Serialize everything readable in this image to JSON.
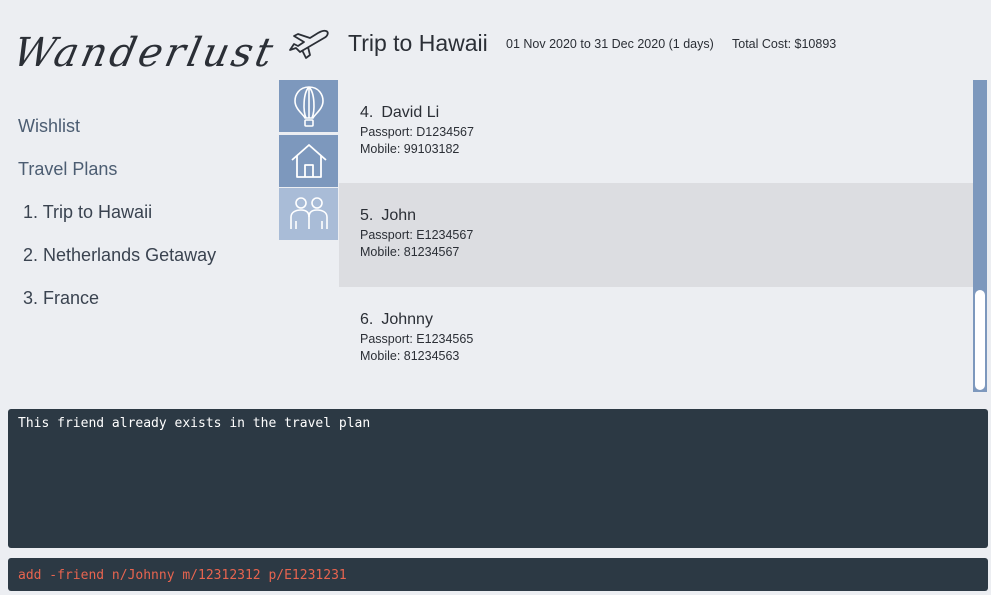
{
  "app": {
    "logo_text": "Wanderlust"
  },
  "sidebar": {
    "wishlist_label": "Wishlist",
    "travel_plans_label": "Travel Plans",
    "plans": [
      {
        "index": "1.",
        "name": "Trip to Hawaii"
      },
      {
        "index": "2.",
        "name": "Netherlands Getaway"
      },
      {
        "index": "3.",
        "name": "France"
      }
    ]
  },
  "header": {
    "title": "Trip to Hawaii",
    "dates": "01 Nov 2020 to 31 Dec 2020 (1 days)",
    "cost": "Total Cost: $10893",
    "icon": "airplane-icon"
  },
  "tabs": [
    {
      "icon": "hot-air-balloon-icon"
    },
    {
      "icon": "house-icon"
    },
    {
      "icon": "friends-icon"
    }
  ],
  "friends": [
    {
      "index": "4.",
      "name": "David Li",
      "passport": "Passport: D1234567",
      "mobile": "Mobile: 99103182"
    },
    {
      "index": "5.",
      "name": "John",
      "passport": "Passport: E1234567",
      "mobile": "Mobile: 81234567"
    },
    {
      "index": "6.",
      "name": "Johnny",
      "passport": "Passport: E1234565",
      "mobile": "Mobile: 81234563"
    }
  ],
  "result": {
    "message": "This friend already exists in the travel plan"
  },
  "command": {
    "value": "add -friend n/Johnny m/12312312 p/E1231231"
  },
  "colors": {
    "tab_active": "#a9bcd7",
    "tab": "#7d98bd",
    "console_bg": "#2c3944",
    "command_text": "#e8644f"
  }
}
